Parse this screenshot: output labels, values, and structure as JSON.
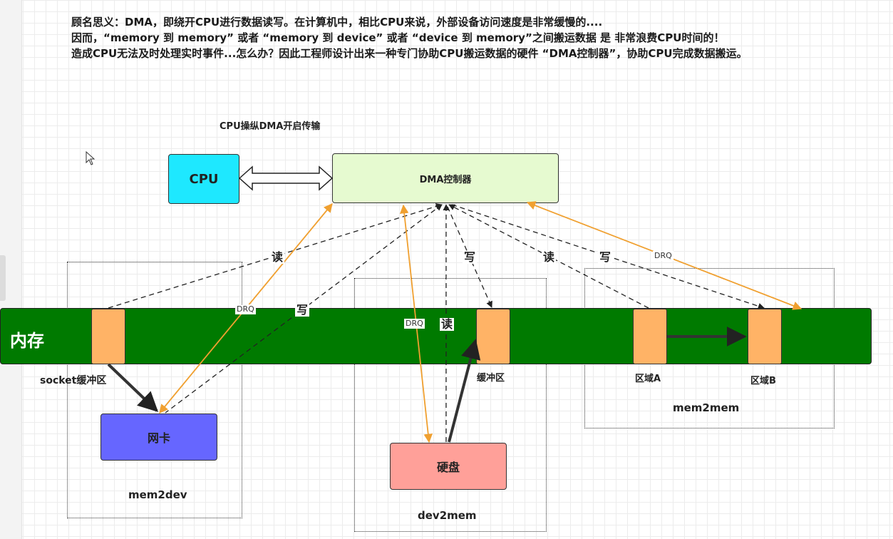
{
  "intro": {
    "line1": "顾名思义：DMA，即绕开CPU进行数据读写。在计算机中，相比CPU来说，外部设备访问速度是非常缓慢的....",
    "line2": "因而，“memory 到 memory” 或者 “memory 到 device” 或者 “device 到 memory”之间搬运数据 是 非常浪费CPU时间的！",
    "line3": "造成CPU无法及时处理实时事件...怎么办？因此工程师设计出来一种专门协助CPU搬运数据的硬件 “DMA控制器”，协助CPU完成数据搬运。"
  },
  "diagram": {
    "caption": "CPU操纵DMA开启传输",
    "cpu": "CPU",
    "dma": "DMA控制器",
    "memory": "内存",
    "nic": "网卡",
    "disk": "硬盘",
    "socket_buffer": "socket缓冲区",
    "buffer": "缓冲区",
    "region_a": "区域A",
    "region_b": "区域B",
    "mem2dev": "mem2dev",
    "dev2mem": "dev2mem",
    "mem2mem": "mem2mem",
    "labels": {
      "read1": "读",
      "write1": "写",
      "write2": "写",
      "read2": "读",
      "read3": "读",
      "write3": "写"
    },
    "drq": {
      "a": "DRQ",
      "b": "DRQ",
      "c": "DRQ"
    }
  },
  "colors": {
    "cpu": "#1ee8ff",
    "dma": "#e6fad0",
    "memory": "#007a00",
    "buffer": "#ffb366",
    "nic": "#6666ff",
    "disk": "#ffa099",
    "drq_line": "#f0a030"
  }
}
